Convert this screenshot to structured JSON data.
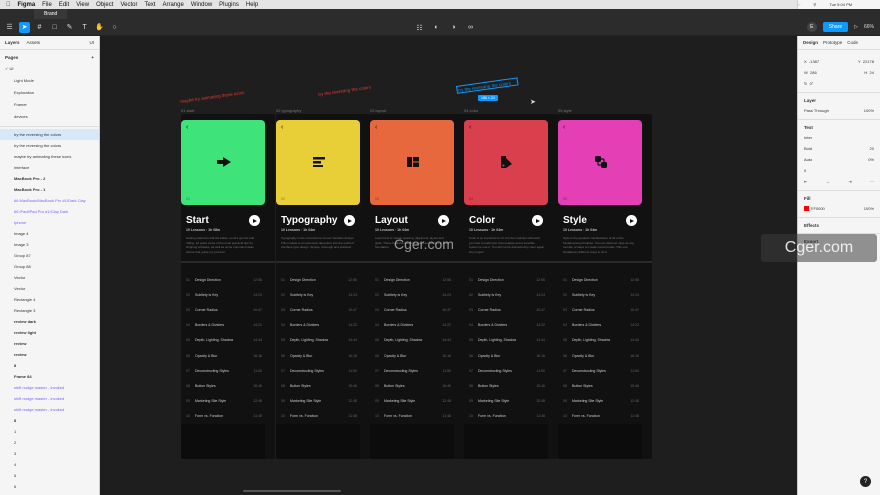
{
  "menubar": {
    "items": [
      "Figma",
      "File",
      "Edit",
      "View",
      "Object",
      "Vector",
      "Text",
      "Arrange",
      "Window",
      "Plugins",
      "Help"
    ],
    "clock": "Tue 5:04 PM"
  },
  "tab": {
    "title": "Brand"
  },
  "toolbar": {
    "zoom": "66%",
    "share": "Share"
  },
  "left_panel": {
    "tabs": [
      "Layers",
      "Assets"
    ],
    "page_indicator": "UI",
    "pages_header": "Pages",
    "pages": [
      "UI",
      "Light Mode",
      "Exploration",
      "Framer",
      "devices"
    ],
    "current_page": "UI",
    "layers": [
      {
        "label": "try the reversing the colors",
        "style": "sel"
      },
      {
        "label": "try the reversing the colors",
        "style": ""
      },
      {
        "label": "maybe try animating these icons",
        "style": ""
      },
      {
        "label": "interface",
        "style": ""
      },
      {
        "label": "MacBook Pro - 2",
        "style": "bold"
      },
      {
        "label": "MacBook Pro - 1",
        "style": "bold"
      },
      {
        "label": "66 MacBook/MacBook Pro #1/Dark Clay",
        "style": "comp"
      },
      {
        "label": "66 iPad/iPad Pro #1/Clay Dark",
        "style": "comp"
      },
      {
        "label": "Iphone",
        "style": "comp"
      },
      {
        "label": "Image 4",
        "style": ""
      },
      {
        "label": "Image 3",
        "style": ""
      },
      {
        "label": "Group 87",
        "style": ""
      },
      {
        "label": "Group 88",
        "style": ""
      },
      {
        "label": "Vector",
        "style": ""
      },
      {
        "label": "Vector",
        "style": ""
      },
      {
        "label": "Rectangle 4",
        "style": ""
      },
      {
        "label": "Rectangle 3",
        "style": ""
      },
      {
        "label": "review dark",
        "style": "bold"
      },
      {
        "label": "review light",
        "style": "bold"
      },
      {
        "label": "review",
        "style": "bold"
      },
      {
        "label": "review",
        "style": "bold"
      },
      {
        "label": "8",
        "style": "bold"
      },
      {
        "label": "Frame 84",
        "style": "bold"
      },
      {
        "label": "shift nudge master - invoked",
        "style": "comp"
      },
      {
        "label": "shift nudge master - invoked",
        "style": "comp"
      },
      {
        "label": "shift nudge master - invoked",
        "style": "comp"
      },
      {
        "label": "8",
        "style": "bold"
      },
      {
        "label": "1",
        "style": ""
      },
      {
        "label": "2",
        "style": ""
      },
      {
        "label": "3",
        "style": ""
      },
      {
        "label": "4",
        "style": ""
      },
      {
        "label": "5",
        "style": ""
      },
      {
        "label": "6",
        "style": ""
      }
    ]
  },
  "canvas": {
    "notes": [
      "maybe try animating these icons",
      "try the reversing the colors",
      "try the reversing the colors"
    ],
    "selection_size": "186 × 24",
    "cards": [
      {
        "label": "01 start",
        "color": "#3ee37a",
        "glyph": "arrow-icon",
        "num": "01",
        "title": "Start",
        "sub": "10 Lessons · 1h 08m",
        "desc": "Getting started is half the battle, so let's get the ball rolling. 10 years some of the most practical tips for shipping software, as well as some important ideas before that guide my process."
      },
      {
        "label": "02 typography",
        "color": "#e8cf38",
        "glyph": "text-icon",
        "num": "02",
        "title": "Typography",
        "sub": "10 Lessons · 1h 04m",
        "desc": "Typography is the cornerstone of user interface design. This module is an extensive deep-dive into the world of interface type design. Simple, thorough and practical."
      },
      {
        "label": "03 layout",
        "color": "#e8683e",
        "glyph": "layout-icon",
        "num": "03",
        "title": "Layout",
        "sub": "10 Lessons · 1h 04m",
        "desc": "Learn how to master spacing, alignment, layout and grids. These fundamentals will give your designs a solid foundation."
      },
      {
        "label": "04 color",
        "color": "#d93f4c",
        "glyph": "palette-icon",
        "num": "04",
        "title": "Color",
        "sub": "10 Lessons · 1h 04m",
        "desc": "Color is so important to UI, but the modules will teach you how to build your color palette and a sensible system to use it. You will not be distracted by color again, any longer!"
      },
      {
        "label": "05 style",
        "color": "#e53fb6",
        "glyph": "style-icon",
        "num": "05",
        "title": "Style",
        "sub": "10 Lessons · 1h 04m",
        "desc": "Style is the greatest manifestation of all of the fundamental principles. You can discover style as any number of ways to create correct looks. This one breakdown different ways to do it."
      }
    ],
    "lessons": [
      {
        "n": "01",
        "t": "Design Direction",
        "d": "12:56"
      },
      {
        "n": "02",
        "t": "Subtlety is Key",
        "d": "14:24"
      },
      {
        "n": "03",
        "t": "Corner Radius",
        "d": "10:47"
      },
      {
        "n": "04",
        "t": "Borders & Dividers",
        "d": "14:22"
      },
      {
        "n": "05",
        "t": "Depth, Lighting, Shadow",
        "d": "14:44"
      },
      {
        "n": "06",
        "t": "Opacity & Blur",
        "d": "16:16"
      },
      {
        "n": "07",
        "t": "Deconstructing Styles",
        "d": "11:50"
      },
      {
        "n": "08",
        "t": "Button Styles",
        "d": "15:46"
      },
      {
        "n": "09",
        "t": "Marketing Site Style",
        "d": "12:48"
      },
      {
        "n": "10",
        "t": "Form vs. Function",
        "d": "11:48"
      }
    ],
    "watermark": "Cger.com"
  },
  "right_panel": {
    "tabs": [
      "Design",
      "Prototype",
      "Code"
    ],
    "x": "-1387",
    "y": "22178",
    "w": "286",
    "h": "24",
    "rotation": "0°",
    "layer_header": "Layer",
    "blend": "Pass Through",
    "opacity": "100%",
    "text_header": "Text",
    "font": "Inter",
    "weight": "Bold",
    "size": "20",
    "line_height": "Auto",
    "letter_spacing": "0%",
    "para": "0",
    "fill_header": "Fill",
    "fill_hex": "FF0000",
    "fill_opacity": "100%",
    "effects_header": "Effects",
    "export_header": "Export",
    "fill_color": "#ff0000"
  }
}
